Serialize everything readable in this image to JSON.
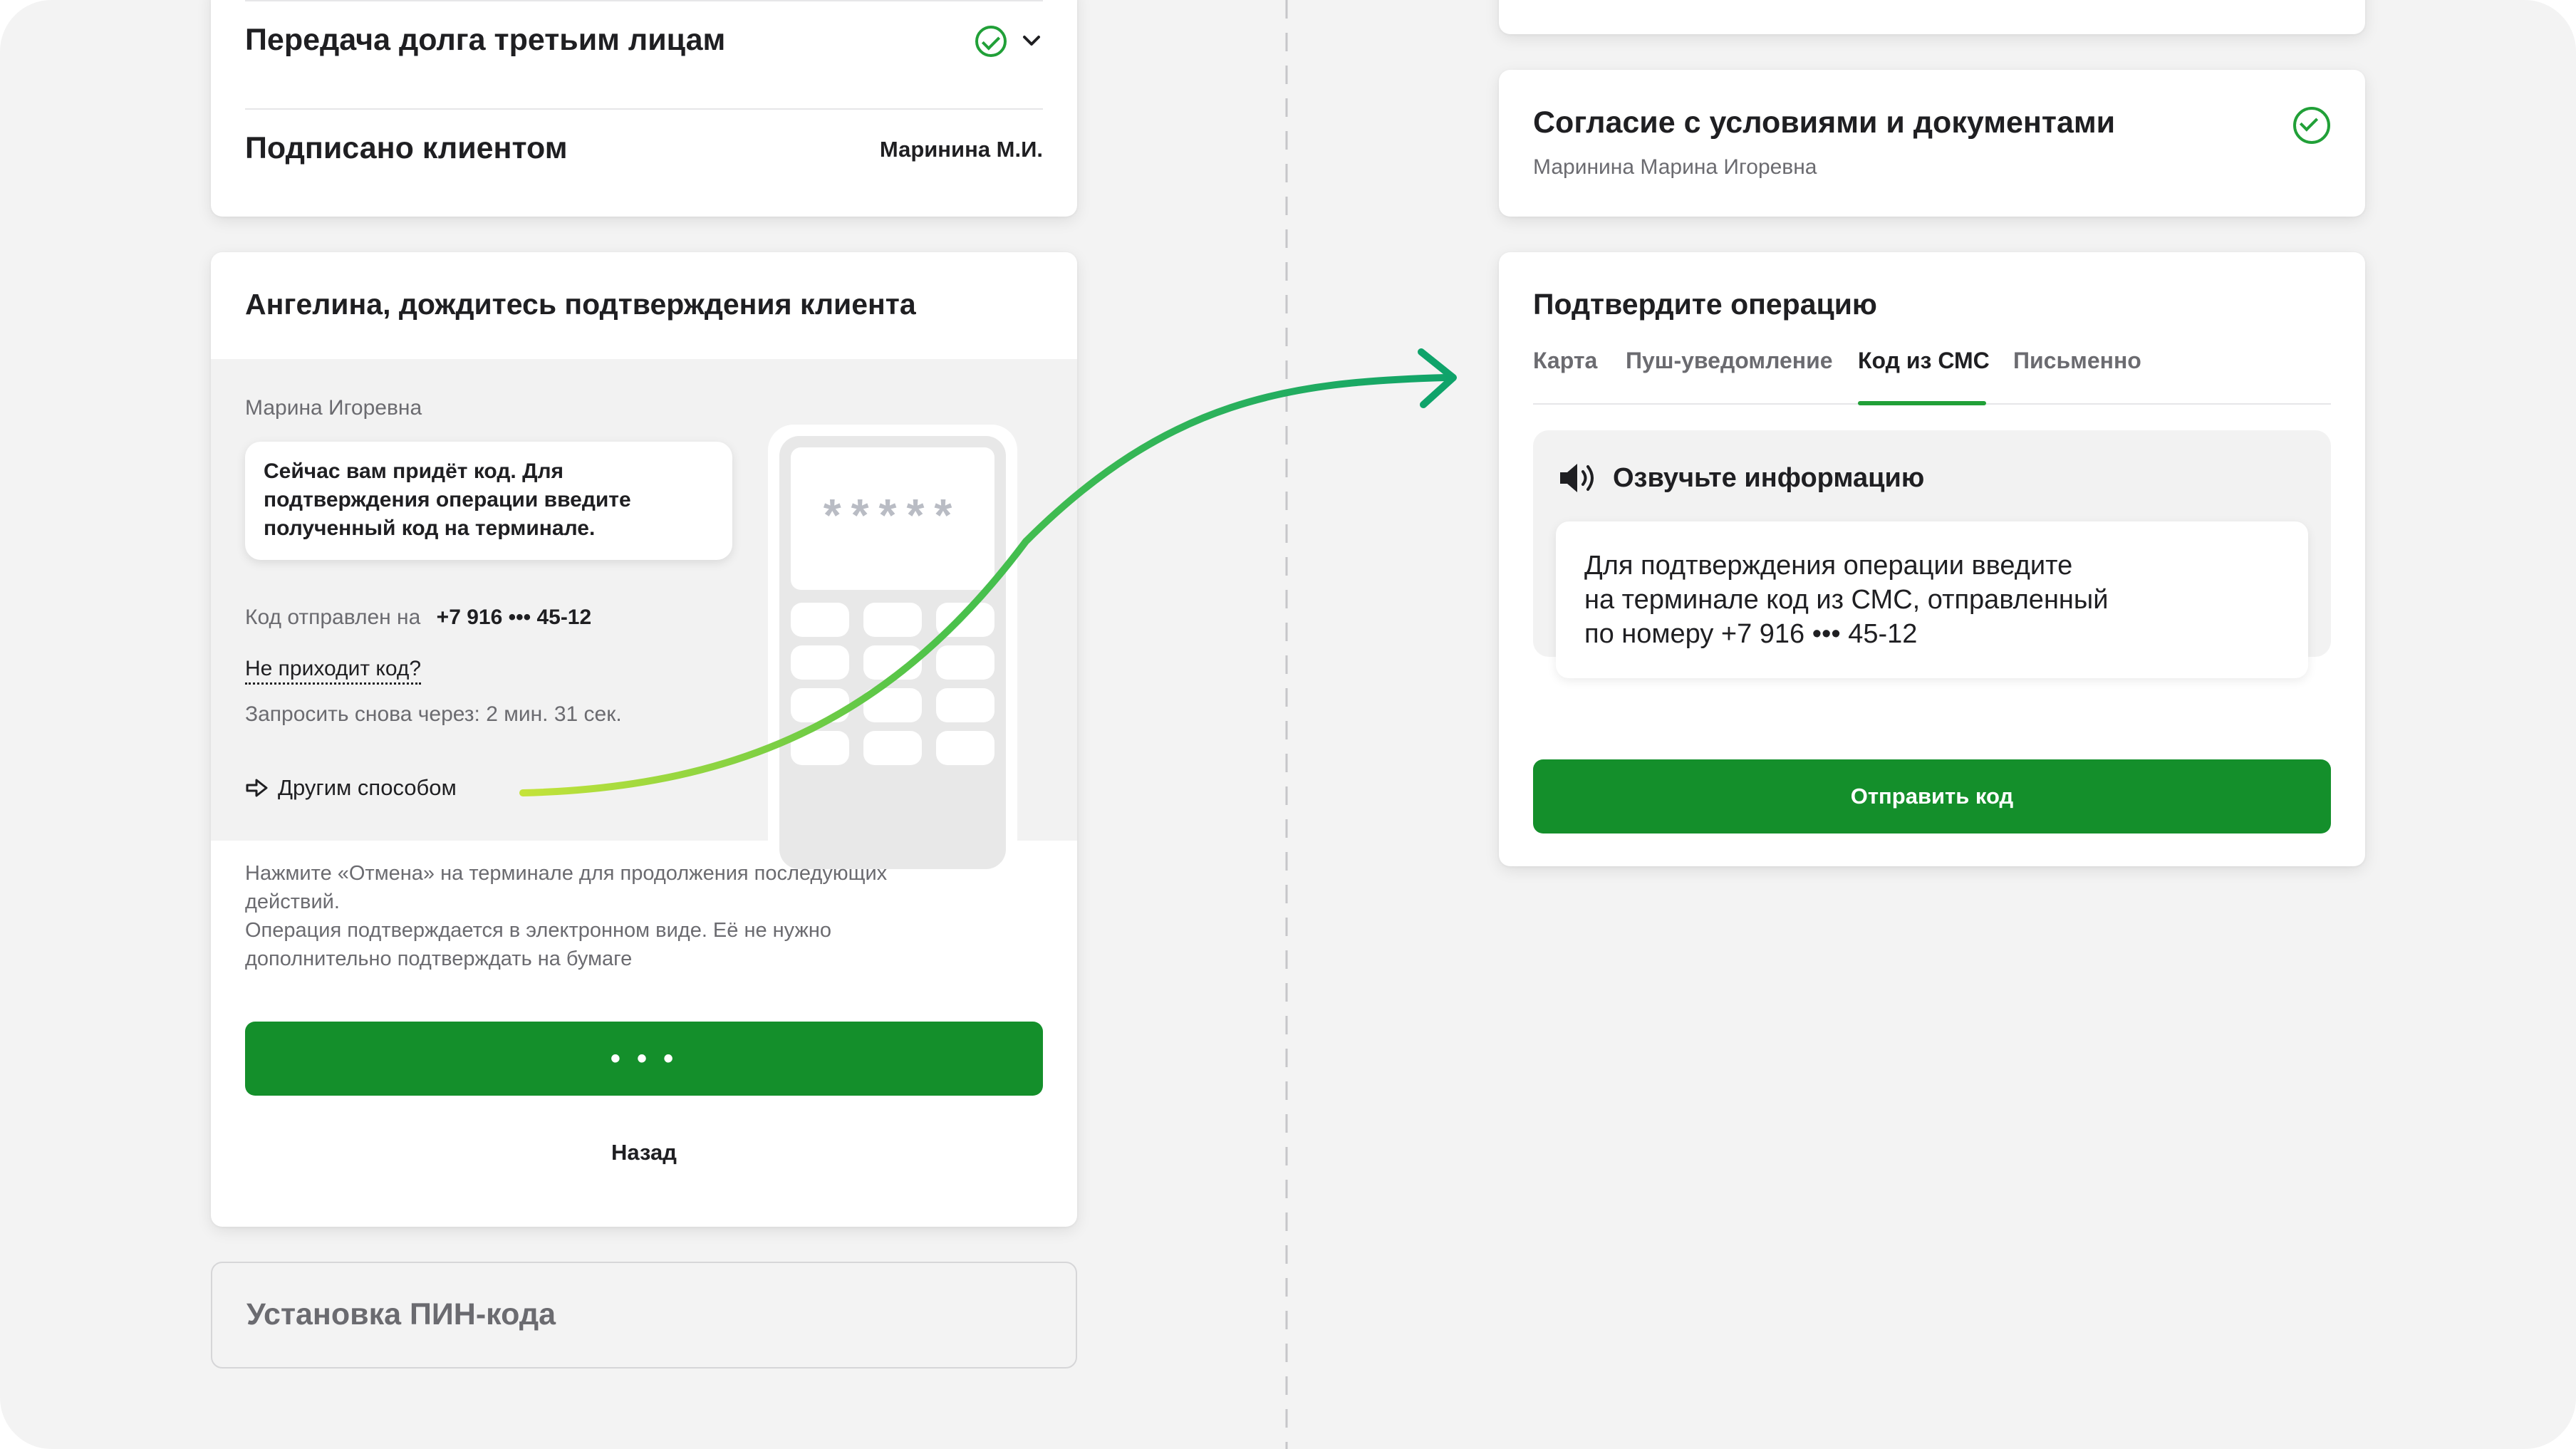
{
  "colors": {
    "accent": "#21a038",
    "button_green": "#148f2b",
    "arrow_start": "#c4e33a",
    "arrow_end": "#0fa36a",
    "background": "#f3f3f3"
  },
  "left": {
    "top_card": {
      "row1_label": "Передача долга третьим лицам",
      "row1_icons": [
        "check-circle-icon",
        "chevron-down-icon"
      ],
      "row2_label": "Подписано клиентом",
      "row2_value": "Маринина М.И."
    },
    "confirm_card": {
      "title": "Ангелина, дождитесь подтверждения клиента",
      "speaker_name": "Марина Игоревна",
      "bubble_text": "Сейчас вам придёт код. Для подтверждения операции введите полученный код на терминале.",
      "code_sent_label": "Код отправлен на",
      "code_sent_phone": "+7 916 ••• 45-12",
      "no_code_link": "Не приходит код?",
      "resend_text": "Запросить снова через: 2 мин. 31 сек.",
      "other_method_label": "Другим способом",
      "other_method_icon": "arrow-right-outline-icon",
      "terminal_mask": "*****",
      "info_text_1": "Нажмите «Отмена» на терминале для продолжения последующих действий.",
      "info_text_2": "Операция подтверждается в электронном виде. Её не нужно дополнительно подтверждать на бумаге",
      "loading_button_label": "• • •",
      "back_label": "Назад"
    },
    "pin_card": {
      "title": "Установка ПИН-кода"
    }
  },
  "right": {
    "consent_card": {
      "title": "Согласие с условиями и документами",
      "subtitle": "Маринина Марина Игоревна",
      "icon": "check-circle-icon"
    },
    "operation_card": {
      "title": "Подтвердите операцию",
      "tabs": [
        {
          "label": "Карта",
          "active": false
        },
        {
          "label": "Пуш-уведомление",
          "active": false
        },
        {
          "label": "Код из СМС",
          "active": true
        },
        {
          "label": "Письменно",
          "active": false
        }
      ],
      "voice_title": "Озвучьте информацию",
      "voice_icon": "speaker-icon",
      "voice_text_line1": "Для подтверждения операции введите",
      "voice_text_line2": "на терминале код из СМС, отправленный",
      "voice_text_line3": "по номеру +7 916 ••• 45-12",
      "send_button_label": "Отправить код"
    }
  }
}
